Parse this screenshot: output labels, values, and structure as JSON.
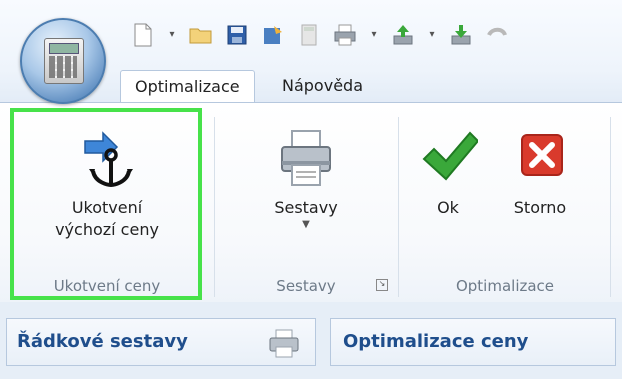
{
  "quick_access": {
    "icons": [
      "new-document-icon",
      "dropdown-arrow-icon",
      "open-folder-icon",
      "save-icon",
      "properties-icon",
      "calculator-icon",
      "print-icon",
      "dropdown-arrow-icon",
      "upload-icon",
      "dropdown-arrow-icon",
      "download-icon",
      "undo-icon"
    ]
  },
  "tabs": [
    {
      "label": "Optimalizace",
      "active": true
    },
    {
      "label": "Nápověda",
      "active": false
    }
  ],
  "ribbon": {
    "groups": [
      {
        "label": "Ukotvení ceny",
        "buttons": [
          {
            "line1": "Ukotvení",
            "line2": "výchozí ceny",
            "icon": "anchor-icon"
          }
        ]
      },
      {
        "label": "Sestavy",
        "buttons": [
          {
            "line1": "Sestavy",
            "icon": "printer-icon",
            "has_dropdown": true
          }
        ]
      },
      {
        "label": "Optimalizace",
        "buttons": [
          {
            "line1": "Ok",
            "icon": "check-icon"
          },
          {
            "line1": "Storno",
            "icon": "cancel-icon"
          }
        ]
      }
    ]
  },
  "bottom_bar": {
    "left_title": "Řádkové sestavy",
    "right_title": "Optimalizace ceny"
  },
  "colors": {
    "highlight_border": "#47e24a",
    "title_blue": "#1f4e8c",
    "check_green": "#3aa83a",
    "cancel_red": "#d93a2c"
  }
}
